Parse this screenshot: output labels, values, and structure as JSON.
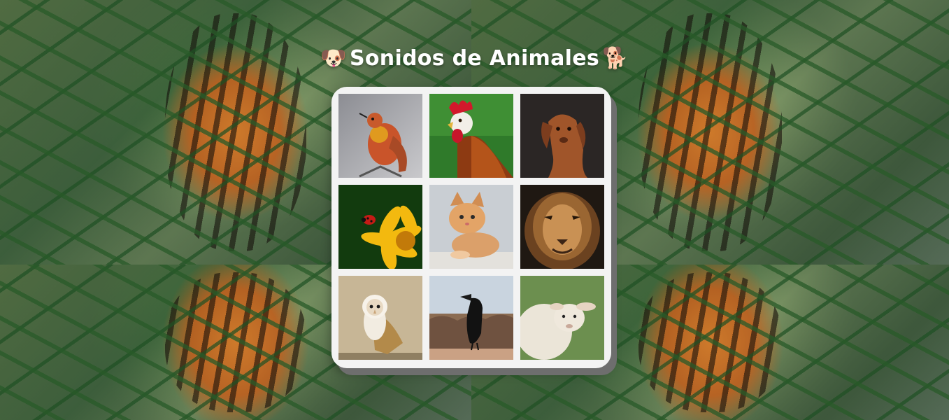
{
  "title": {
    "text": "Sonidos de Animales",
    "left_emoji": "🐶",
    "right_emoji": "🐕"
  },
  "background": {
    "image": "tiger-jungle"
  },
  "board": {
    "tiles": [
      {
        "animal": "hummingbird",
        "icon": "hummingbird-image"
      },
      {
        "animal": "rooster",
        "icon": "rooster-image"
      },
      {
        "animal": "dog",
        "icon": "dog-image"
      },
      {
        "animal": "ladybug",
        "icon": "ladybug-flower-image"
      },
      {
        "animal": "cat",
        "icon": "kitten-image"
      },
      {
        "animal": "lion",
        "icon": "lion-image"
      },
      {
        "animal": "owl",
        "icon": "owl-image"
      },
      {
        "animal": "crow",
        "icon": "crow-image"
      },
      {
        "animal": "sheep",
        "icon": "sheep-image"
      }
    ]
  },
  "colors": {
    "board_bg": "#f3f3f3",
    "board_shadow": "#6e6e6e",
    "title_text": "#ffffff"
  }
}
